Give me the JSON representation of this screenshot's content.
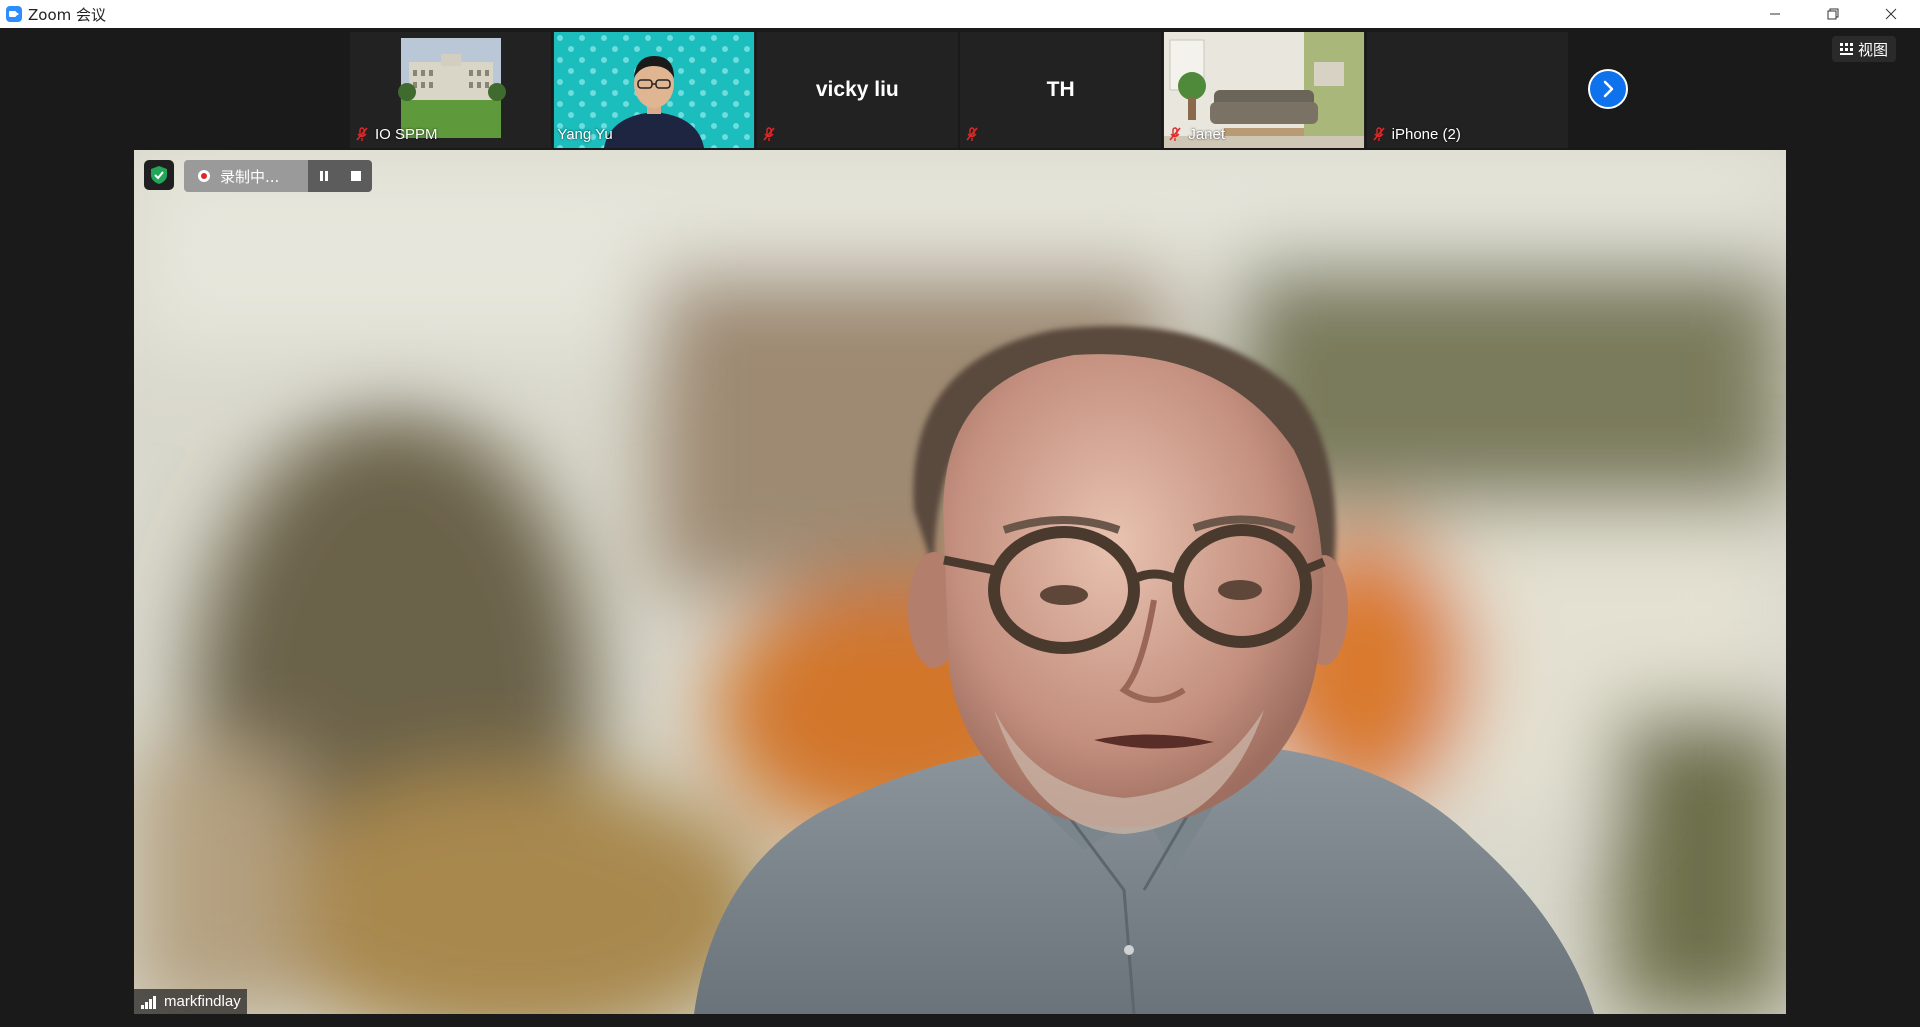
{
  "window": {
    "title": "Zoom 会议",
    "minimize_glyph": "—",
    "restore_glyph": "❐",
    "close_glyph": "✕"
  },
  "view_button": {
    "label": "视图",
    "icon": "grid-icon"
  },
  "participants": [
    {
      "name": "IO SPPM",
      "muted": true,
      "has_video": true,
      "video": "building-photo"
    },
    {
      "name": "Yang Yu",
      "muted": false,
      "has_video": true,
      "video": "person-teal-background"
    },
    {
      "name": "vicky liu",
      "muted": true,
      "has_video": false,
      "display_text": "vicky liu"
    },
    {
      "name": "TH",
      "muted": true,
      "has_video": false,
      "display_text": "TH"
    },
    {
      "name": "Janet",
      "muted": true,
      "has_video": true,
      "video": "living-room-photo"
    },
    {
      "name": "iPhone (2)",
      "muted": true,
      "has_video": false,
      "display_text": ""
    }
  ],
  "next_page_icon": "chevron-right-icon",
  "recording": {
    "status": "录制中...",
    "pause_icon": "pause-icon",
    "stop_icon": "stop-icon"
  },
  "security_icon": "shield-check-icon",
  "active_speaker": {
    "name": "markfindlay",
    "signal_icon": "signal-bars-icon"
  },
  "colors": {
    "accent": "#0e72ed",
    "muted_red": "#e02828",
    "shield_green": "#23a55a",
    "tile_teal": "#1bbdbd"
  }
}
